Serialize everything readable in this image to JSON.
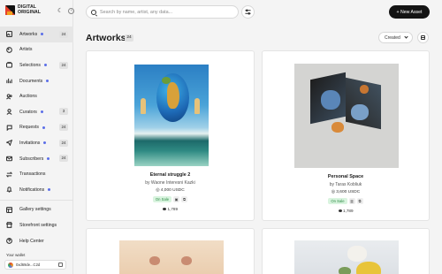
{
  "brand": {
    "line1": "DIGITAL",
    "line2": "ORIGINAL"
  },
  "sidebar": {
    "items": [
      {
        "label": "Artworks",
        "icon": "image-icon",
        "badge": "24",
        "dot": true,
        "active": true
      },
      {
        "label": "Artists",
        "icon": "palette-icon",
        "badge": "",
        "dot": false
      },
      {
        "label": "Selections",
        "icon": "folders-icon",
        "badge": "24",
        "dot": true
      },
      {
        "label": "Documents",
        "icon": "chart-bars-icon",
        "badge": "",
        "dot": true
      },
      {
        "label": "Auctions",
        "icon": "users-icon",
        "badge": "",
        "dot": false
      },
      {
        "label": "Curators",
        "icon": "person-icon",
        "badge": "3",
        "dot": true
      },
      {
        "label": "Requests",
        "icon": "chat-icon",
        "badge": "24",
        "dot": true
      },
      {
        "label": "Invitations",
        "icon": "send-icon",
        "badge": "24",
        "dot": true
      },
      {
        "label": "Subscribers",
        "icon": "mail-icon",
        "badge": "24",
        "dot": true
      },
      {
        "label": "Transactions",
        "icon": "swap-icon",
        "badge": "",
        "dot": false
      },
      {
        "label": "Notifications",
        "icon": "bell-icon",
        "badge": "",
        "dot": true
      }
    ],
    "bottom": [
      {
        "label": "Gallery settings",
        "icon": "gallery-settings-icon"
      },
      {
        "label": "Storefront settings",
        "icon": "storefront-icon"
      },
      {
        "label": "Help Center",
        "icon": "help-icon"
      }
    ],
    "wallet_label": "Your wallet",
    "wallet_address": "0xd69de...C2d"
  },
  "header": {
    "search_placeholder": "Search by name, artist, any data...",
    "new_asset": "+ New Asset"
  },
  "page": {
    "title": "Artworks",
    "count": "24",
    "sort": "Created"
  },
  "cards": [
    {
      "title": "Eternal struggle 2",
      "artist": "by Waone Interesni Kazki",
      "price": "4,000 USDC",
      "status": "On Sale",
      "views": "1,789"
    },
    {
      "title": "Personal Space",
      "artist": "by Taras Kobliuk",
      "price": "3,600 USDC",
      "status": "On Sale",
      "views": "1,789"
    }
  ],
  "colors": {
    "accent_dot": "#5b6ee8",
    "on_sale_bg": "#d9f4df",
    "on_sale_text": "#2c8a44",
    "primary_button": "#141414"
  }
}
